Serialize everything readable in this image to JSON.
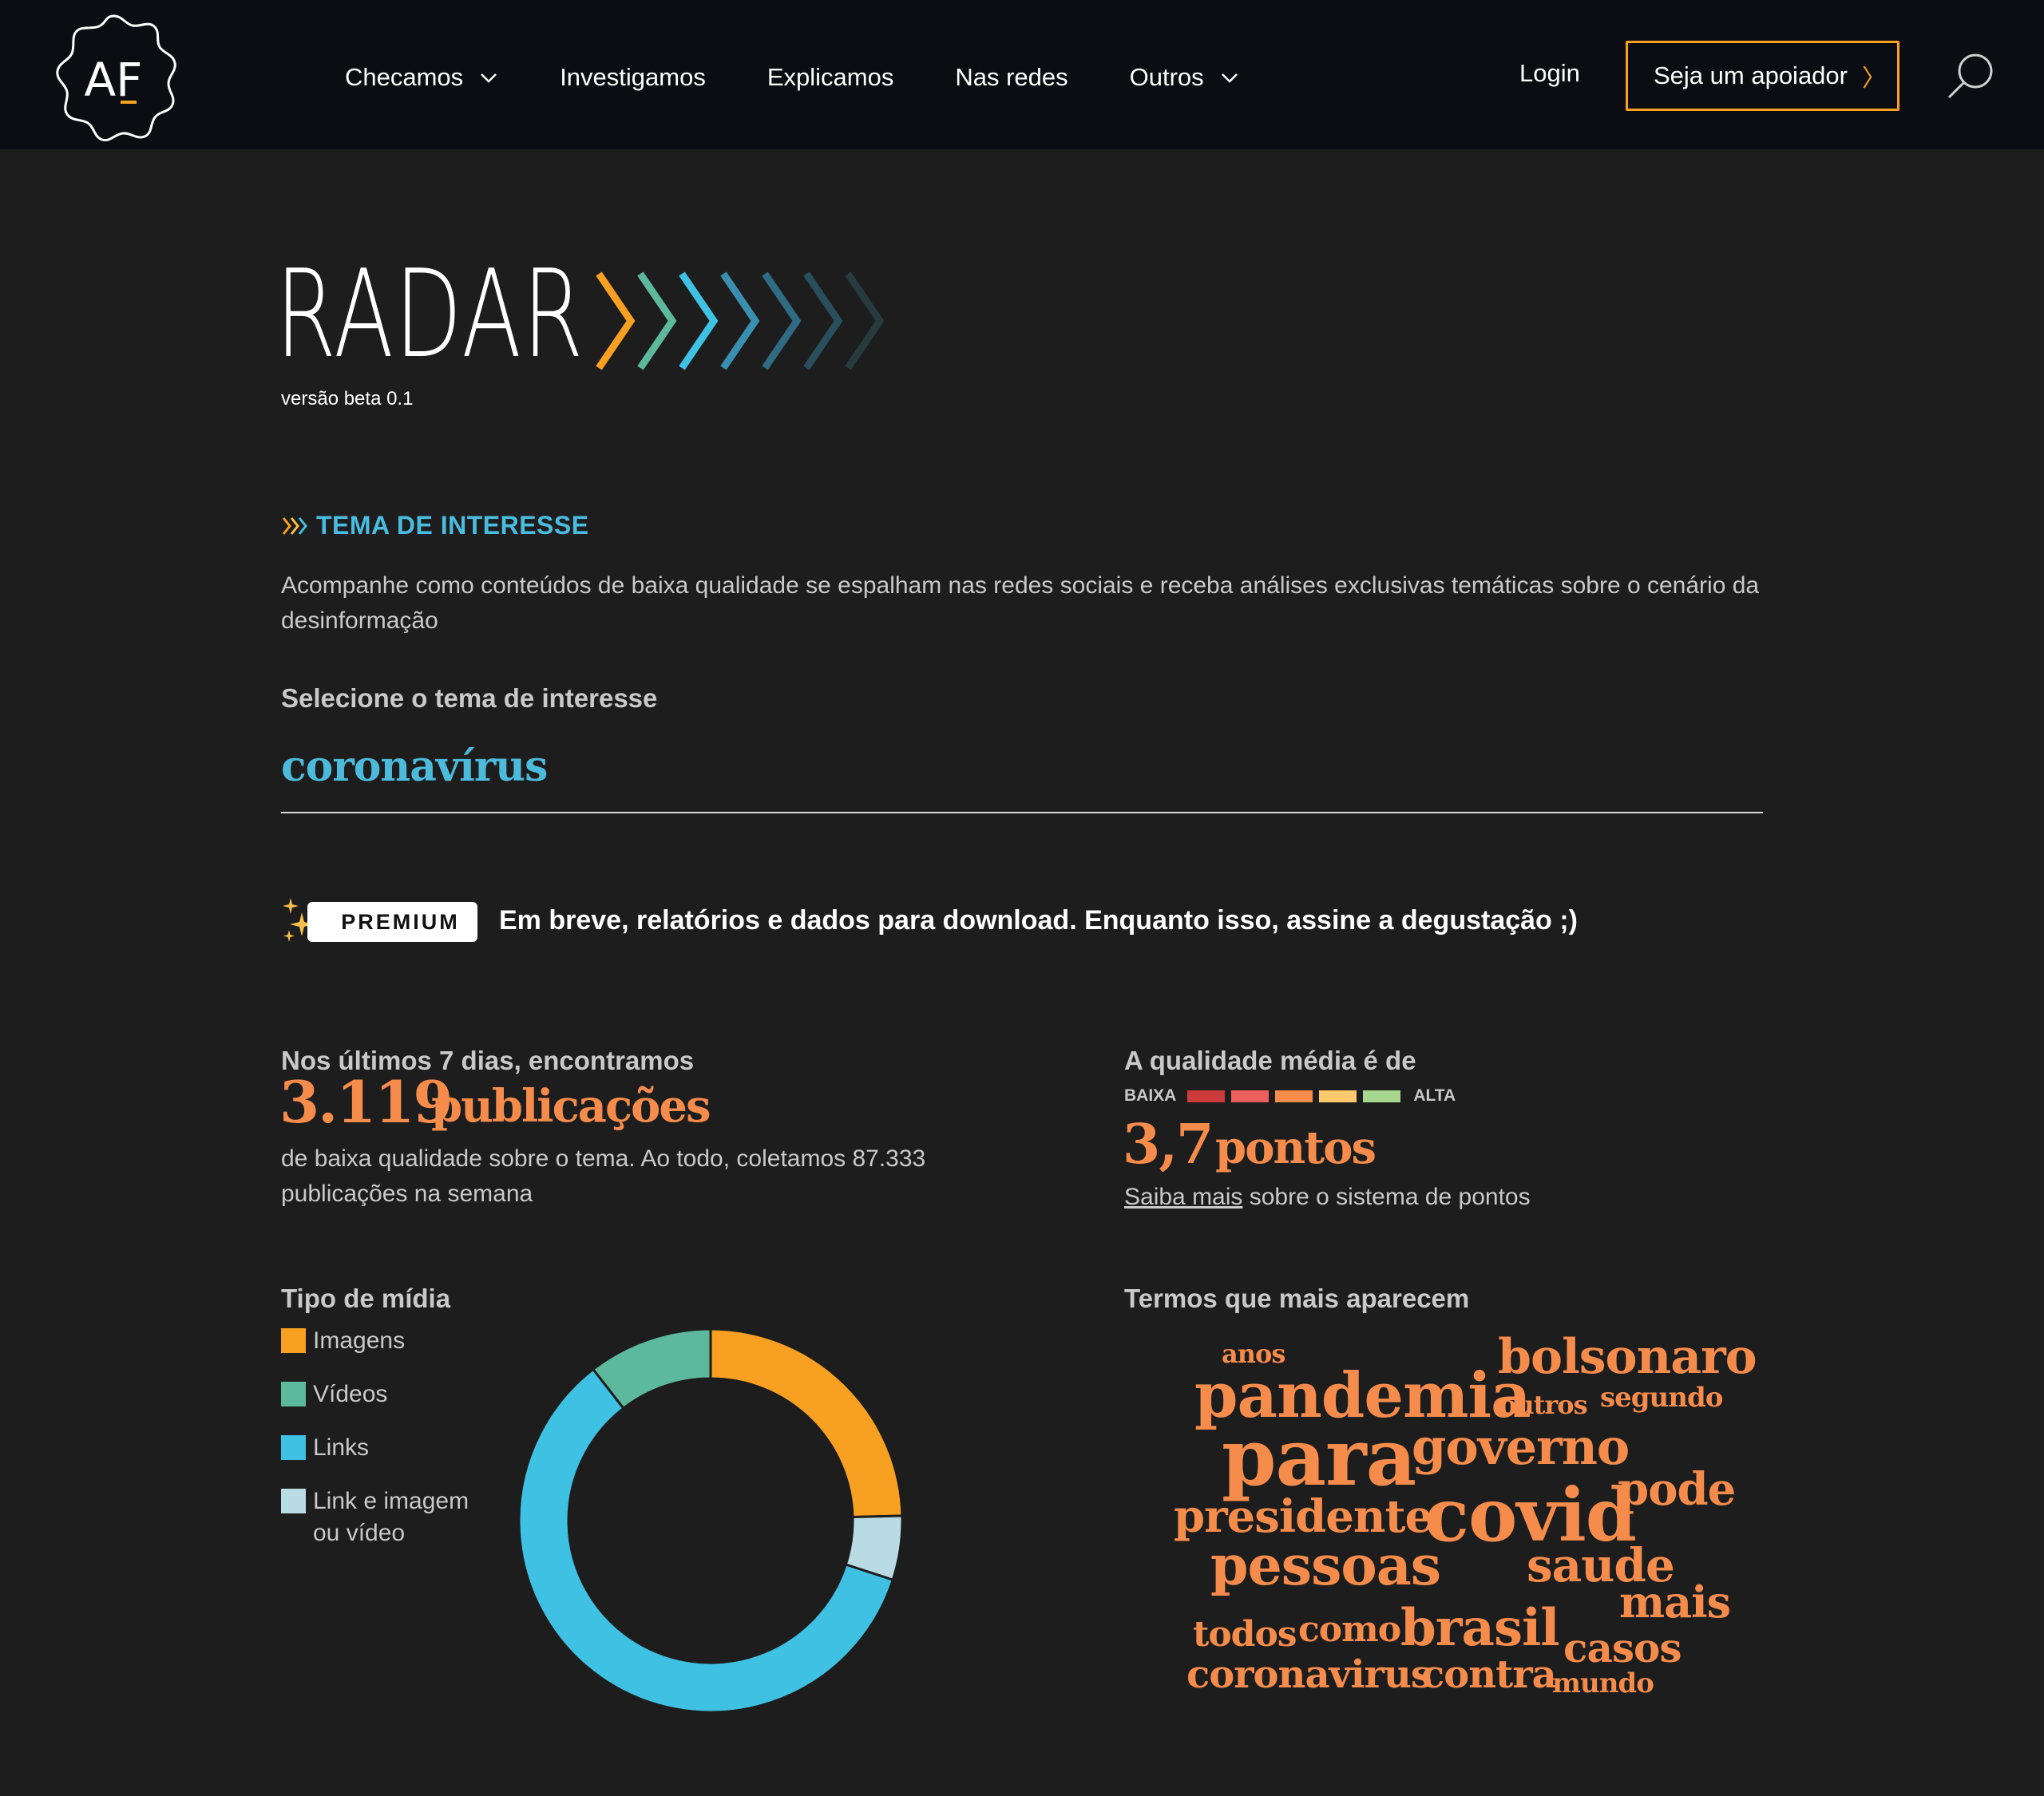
{
  "header": {
    "logo_text": "AF",
    "nav": [
      {
        "label": "Checamos",
        "has_dropdown": true
      },
      {
        "label": "Investigamos",
        "has_dropdown": false
      },
      {
        "label": "Explicamos",
        "has_dropdown": false
      },
      {
        "label": "Nas redes",
        "has_dropdown": false
      },
      {
        "label": "Outros",
        "has_dropdown": true
      }
    ],
    "login": "Login",
    "support_button": "Seja um apoiador",
    "support_arrow": "〉"
  },
  "brand": {
    "title": "RADAR",
    "version": "versão beta 0.1"
  },
  "section": {
    "title": "TEMA DE INTERESSE",
    "description": "Acompanhe como conteúdos de baixa qualidade se espalham nas redes sociais e receba análises exclusivas temáticas sobre o cenário da desinformação",
    "select_label": "Selecione o tema de interesse",
    "selected_topic": "coronavírus"
  },
  "premium": {
    "badge": "PREMIUM",
    "text": "Em breve, relatórios e dados para download. Enquanto isso, assine a degustação ;)"
  },
  "stats": {
    "publications": {
      "label": "Nos últimos 7 dias, encontramos",
      "value": "3.119",
      "unit": "publicações",
      "description": "de baixa qualidade sobre o tema. Ao todo, coletamos 87.333 publicações na semana"
    },
    "quality": {
      "label": "A qualidade média é de",
      "scale_low": "BAIXA",
      "scale_high": "ALTA",
      "scale_colors": [
        "#cc3b3b",
        "#ee5f5f",
        "#f58c4c",
        "#fbc86b",
        "#a8d88f"
      ],
      "value": "3,7",
      "unit": "pontos",
      "link_text": "Saiba mais",
      "link_suffix": "sobre o sistema de pontos"
    }
  },
  "media_type": {
    "title": "Tipo de mídia",
    "legend": [
      {
        "label": "Imagens",
        "color": "#f7a021"
      },
      {
        "label": "Vídeos",
        "color": "#5cb99b"
      },
      {
        "label": "Links",
        "color": "#3ec1e2"
      },
      {
        "label": "Link e imagem ou vídeo",
        "color": "#b9dbe4"
      }
    ]
  },
  "chart_data": {
    "type": "pie",
    "title": "Tipo de mídia",
    "categories": [
      "Imagens",
      "Link e imagem ou vídeo",
      "Links",
      "Vídeos"
    ],
    "values": [
      24.6,
      5.4,
      59.5,
      10.5
    ],
    "colors": [
      "#f7a021",
      "#b9dbe4",
      "#3ec1e2",
      "#5cb99b"
    ],
    "donut": true
  },
  "word_cloud": {
    "title": "Termos que mais aparecem",
    "words": [
      {
        "text": "anos",
        "size": "small"
      },
      {
        "text": "bolsonaro",
        "size": "large"
      },
      {
        "text": "pandemia",
        "size": "xlarge"
      },
      {
        "text": "outros",
        "size": "small"
      },
      {
        "text": "segundo",
        "size": "small"
      },
      {
        "text": "para",
        "size": "xxlarge"
      },
      {
        "text": "governo",
        "size": "large"
      },
      {
        "text": "pode",
        "size": "large"
      },
      {
        "text": "presidente",
        "size": "large"
      },
      {
        "text": "covid",
        "size": "xxlarge"
      },
      {
        "text": "pessoas",
        "size": "xlarge"
      },
      {
        "text": "saude",
        "size": "large"
      },
      {
        "text": "mais",
        "size": "large"
      },
      {
        "text": "todos",
        "size": "medium"
      },
      {
        "text": "como",
        "size": "medium"
      },
      {
        "text": "brasil",
        "size": "xlarge"
      },
      {
        "text": "casos",
        "size": "large"
      },
      {
        "text": "coronavirus",
        "size": "medium"
      },
      {
        "text": "contra",
        "size": "medium"
      },
      {
        "text": "mundo",
        "size": "small"
      }
    ]
  }
}
